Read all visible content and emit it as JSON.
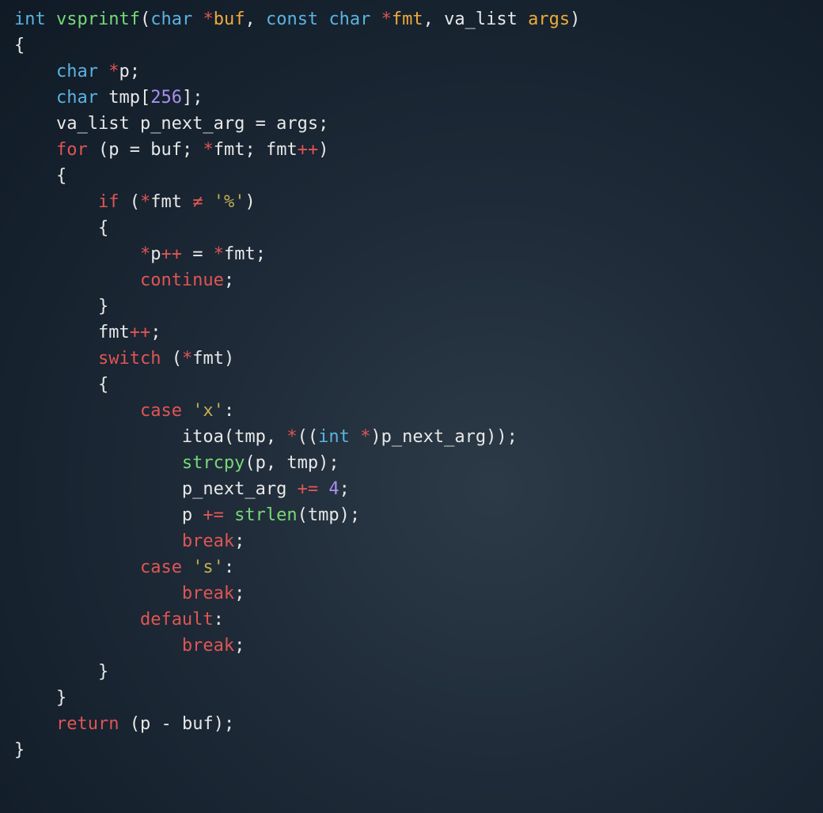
{
  "syntax_colors": {
    "type": "#5bb3e0",
    "function": "#78d978",
    "operator_star": "#e05555",
    "parameter": "#f0a93a",
    "identifier": "#e8e8e8",
    "punctuation": "#e8e8e8",
    "keyword": "#e05555",
    "number": "#a890f0",
    "string": "#c0b050"
  },
  "code_tokens": [
    [
      [
        "type",
        "int"
      ],
      [
        "text",
        " "
      ],
      [
        "func",
        "vsprintf"
      ],
      [
        "punc",
        "("
      ],
      [
        "type",
        "char"
      ],
      [
        "text",
        " "
      ],
      [
        "star",
        "*"
      ],
      [
        "param",
        "buf"
      ],
      [
        "punc",
        ", "
      ],
      [
        "type",
        "const"
      ],
      [
        "text",
        " "
      ],
      [
        "type",
        "char"
      ],
      [
        "text",
        " "
      ],
      [
        "star",
        "*"
      ],
      [
        "param",
        "fmt"
      ],
      [
        "punc",
        ", "
      ],
      [
        "ident",
        "va_list "
      ],
      [
        "param",
        "args"
      ],
      [
        "punc",
        ")"
      ]
    ],
    [
      [
        "punc",
        "{"
      ]
    ],
    [
      [
        "text",
        "    "
      ],
      [
        "type",
        "char"
      ],
      [
        "text",
        " "
      ],
      [
        "star",
        "*"
      ],
      [
        "ident",
        "p"
      ],
      [
        "punc",
        ";"
      ]
    ],
    [
      [
        "text",
        "    "
      ],
      [
        "type",
        "char"
      ],
      [
        "text",
        " "
      ],
      [
        "ident",
        "tmp"
      ],
      [
        "punc",
        "["
      ],
      [
        "num",
        "256"
      ],
      [
        "punc",
        "];"
      ]
    ],
    [
      [
        "text",
        "    "
      ],
      [
        "ident",
        "va_list p_next_arg "
      ],
      [
        "punc",
        "= "
      ],
      [
        "ident",
        "args"
      ],
      [
        "punc",
        ";"
      ]
    ],
    [
      [
        "text",
        "    "
      ],
      [
        "kw",
        "for"
      ],
      [
        "text",
        " "
      ],
      [
        "punc",
        "("
      ],
      [
        "ident",
        "p "
      ],
      [
        "punc",
        "= "
      ],
      [
        "ident",
        "buf"
      ],
      [
        "punc",
        "; "
      ],
      [
        "star",
        "*"
      ],
      [
        "ident",
        "fmt"
      ],
      [
        "punc",
        "; "
      ],
      [
        "ident",
        "fmt"
      ],
      [
        "star",
        "++"
      ],
      [
        "punc",
        ")"
      ]
    ],
    [
      [
        "text",
        "    "
      ],
      [
        "punc",
        "{"
      ]
    ],
    [
      [
        "text",
        "        "
      ],
      [
        "kw",
        "if"
      ],
      [
        "text",
        " "
      ],
      [
        "punc",
        "("
      ],
      [
        "star",
        "*"
      ],
      [
        "ident",
        "fmt "
      ],
      [
        "neq",
        "≠"
      ],
      [
        "text",
        " "
      ],
      [
        "str",
        "'%'"
      ],
      [
        "punc",
        ")"
      ]
    ],
    [
      [
        "text",
        "        "
      ],
      [
        "punc",
        "{"
      ]
    ],
    [
      [
        "text",
        "            "
      ],
      [
        "star",
        "*"
      ],
      [
        "ident",
        "p"
      ],
      [
        "star",
        "++"
      ],
      [
        "text",
        " "
      ],
      [
        "punc",
        "= "
      ],
      [
        "star",
        "*"
      ],
      [
        "ident",
        "fmt"
      ],
      [
        "punc",
        ";"
      ]
    ],
    [
      [
        "text",
        "            "
      ],
      [
        "kw",
        "continue"
      ],
      [
        "punc",
        ";"
      ]
    ],
    [
      [
        "text",
        "        "
      ],
      [
        "punc",
        "}"
      ]
    ],
    [
      [
        "text",
        "        "
      ],
      [
        "ident",
        "fmt"
      ],
      [
        "star",
        "++"
      ],
      [
        "punc",
        ";"
      ]
    ],
    [
      [
        "text",
        "        "
      ],
      [
        "kw",
        "switch"
      ],
      [
        "text",
        " "
      ],
      [
        "punc",
        "("
      ],
      [
        "star",
        "*"
      ],
      [
        "ident",
        "fmt"
      ],
      [
        "punc",
        ")"
      ]
    ],
    [
      [
        "text",
        "        "
      ],
      [
        "punc",
        "{"
      ]
    ],
    [
      [
        "text",
        "            "
      ],
      [
        "kw",
        "case"
      ],
      [
        "text",
        " "
      ],
      [
        "str",
        "'x'"
      ],
      [
        "punc",
        ":"
      ]
    ],
    [
      [
        "text",
        "                "
      ],
      [
        "ident",
        "itoa"
      ],
      [
        "punc",
        "("
      ],
      [
        "ident",
        "tmp"
      ],
      [
        "punc",
        ", "
      ],
      [
        "star",
        "*"
      ],
      [
        "punc",
        "(("
      ],
      [
        "type",
        "int"
      ],
      [
        "text",
        " "
      ],
      [
        "star",
        "*"
      ],
      [
        "punc",
        ")"
      ],
      [
        "ident",
        "p_next_arg"
      ],
      [
        "punc",
        "));"
      ]
    ],
    [
      [
        "text",
        "                "
      ],
      [
        "func",
        "strcpy"
      ],
      [
        "punc",
        "("
      ],
      [
        "ident",
        "p"
      ],
      [
        "punc",
        ", "
      ],
      [
        "ident",
        "tmp"
      ],
      [
        "punc",
        ");"
      ]
    ],
    [
      [
        "text",
        "                "
      ],
      [
        "ident",
        "p_next_arg "
      ],
      [
        "star",
        "+="
      ],
      [
        "text",
        " "
      ],
      [
        "num",
        "4"
      ],
      [
        "punc",
        ";"
      ]
    ],
    [
      [
        "text",
        "                "
      ],
      [
        "ident",
        "p "
      ],
      [
        "star",
        "+="
      ],
      [
        "text",
        " "
      ],
      [
        "func",
        "strlen"
      ],
      [
        "punc",
        "("
      ],
      [
        "ident",
        "tmp"
      ],
      [
        "punc",
        ");"
      ]
    ],
    [
      [
        "text",
        "                "
      ],
      [
        "kw",
        "break"
      ],
      [
        "punc",
        ";"
      ]
    ],
    [
      [
        "text",
        "            "
      ],
      [
        "kw",
        "case"
      ],
      [
        "text",
        " "
      ],
      [
        "str",
        "'s'"
      ],
      [
        "punc",
        ":"
      ]
    ],
    [
      [
        "text",
        "                "
      ],
      [
        "kw",
        "break"
      ],
      [
        "punc",
        ";"
      ]
    ],
    [
      [
        "text",
        "            "
      ],
      [
        "kw",
        "default"
      ],
      [
        "punc",
        ":"
      ]
    ],
    [
      [
        "text",
        "                "
      ],
      [
        "kw",
        "break"
      ],
      [
        "punc",
        ";"
      ]
    ],
    [
      [
        "text",
        "        "
      ],
      [
        "punc",
        "}"
      ]
    ],
    [
      [
        "text",
        "    "
      ],
      [
        "punc",
        "}"
      ]
    ],
    [
      [
        "text",
        "    "
      ],
      [
        "kw",
        "return"
      ],
      [
        "text",
        " "
      ],
      [
        "punc",
        "("
      ],
      [
        "ident",
        "p "
      ],
      [
        "punc",
        "- "
      ],
      [
        "ident",
        "buf"
      ],
      [
        "punc",
        ");"
      ]
    ],
    [
      [
        "punc",
        "}"
      ]
    ]
  ]
}
